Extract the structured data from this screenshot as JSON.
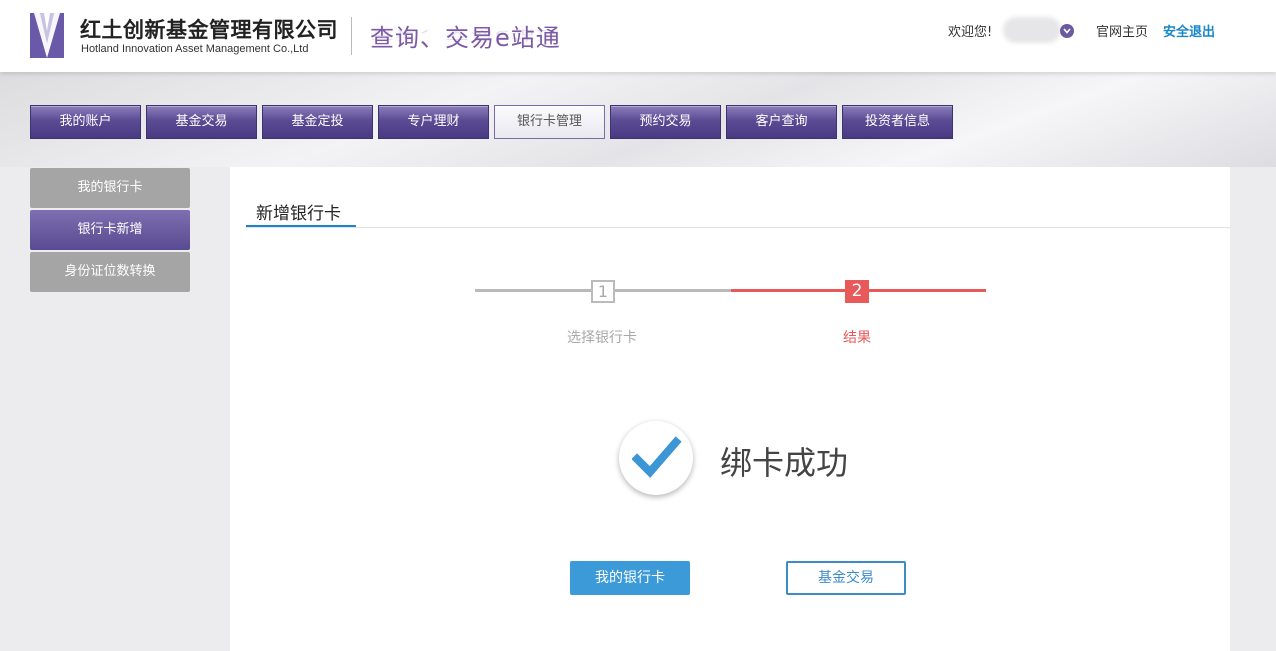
{
  "header": {
    "company_cn": "红土创新基金管理有限公司",
    "company_en": "Hotland Innovation Asset Management Co.,Ltd",
    "slogan": "查询、交易e站通",
    "welcome": "欢迎您!",
    "home_link": "官网主页",
    "logout_link": "安全退出"
  },
  "nav": {
    "items": [
      "我的账户",
      "基金交易",
      "基金定投",
      "专户理财",
      "银行卡管理",
      "预约交易",
      "客户查询",
      "投资者信息"
    ],
    "active": "银行卡管理"
  },
  "sidebar": {
    "items": [
      "我的银行卡",
      "银行卡新增",
      "身份证位数转换"
    ],
    "active": "银行卡新增"
  },
  "main": {
    "tab_title": "新增银行卡",
    "steps": [
      {
        "number": "1",
        "label": "选择银行卡"
      },
      {
        "number": "2",
        "label": "结果"
      }
    ],
    "current_step": 2,
    "success_text": "绑卡成功",
    "primary_button": "我的银行卡",
    "secondary_button": "基金交易"
  },
  "colors": {
    "nav_purple": "#5b4a94",
    "step_active_red": "#e85a5a",
    "primary_blue": "#3c9ad8",
    "link_blue": "#1a86c8"
  }
}
